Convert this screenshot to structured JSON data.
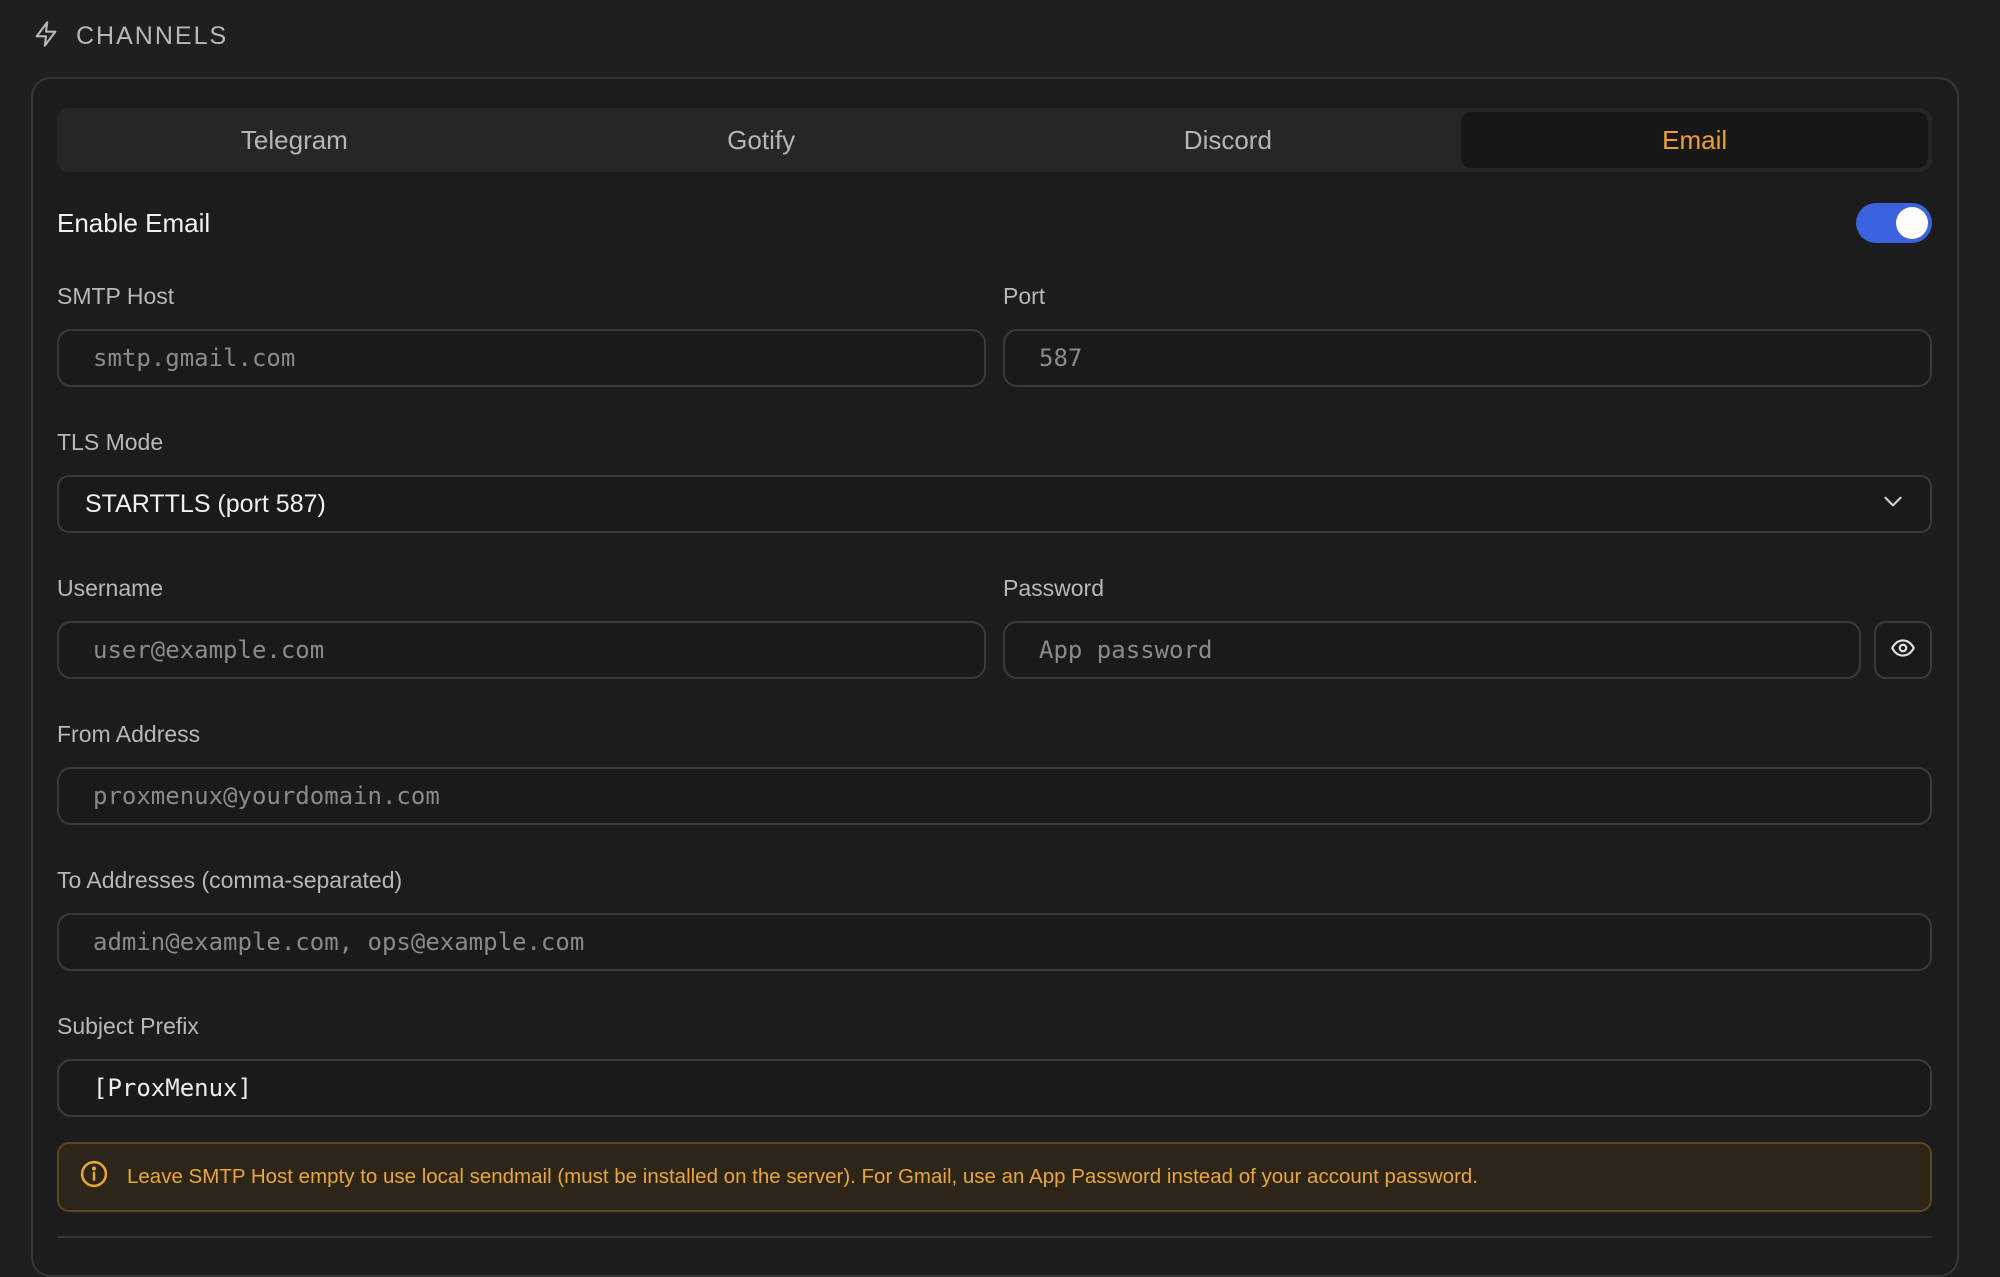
{
  "header": {
    "title": "CHANNELS",
    "icon": "lightning-icon"
  },
  "tabs": [
    {
      "label": "Telegram",
      "active": false
    },
    {
      "label": "Gotify",
      "active": false
    },
    {
      "label": "Discord",
      "active": false
    },
    {
      "label": "Email",
      "active": true
    }
  ],
  "enable": {
    "label": "Enable Email",
    "enabled": true
  },
  "smtp_host": {
    "label": "SMTP Host",
    "placeholder": "smtp.gmail.com",
    "value": ""
  },
  "port": {
    "label": "Port",
    "placeholder": "587",
    "value": ""
  },
  "tls_mode": {
    "label": "TLS Mode",
    "selected": "STARTTLS (port 587)"
  },
  "username": {
    "label": "Username",
    "placeholder": "user@example.com",
    "value": ""
  },
  "password": {
    "label": "Password",
    "placeholder": "App password",
    "value": ""
  },
  "from_address": {
    "label": "From Address",
    "placeholder": "proxmenux@yourdomain.com",
    "value": ""
  },
  "to_addresses": {
    "label": "To Addresses (comma-separated)",
    "placeholder": "admin@example.com, ops@example.com",
    "value": ""
  },
  "subject_prefix": {
    "label": "Subject Prefix",
    "value": "[ProxMenux]"
  },
  "notice": {
    "text": "Leave SMTP Host empty to use local sendmail (must be installed on the server). For Gmail, use an App Password instead of your account password."
  },
  "colors": {
    "accent": "#f0a030",
    "toggle_on": "#3b63e0",
    "notice_text": "#e9a63a"
  }
}
